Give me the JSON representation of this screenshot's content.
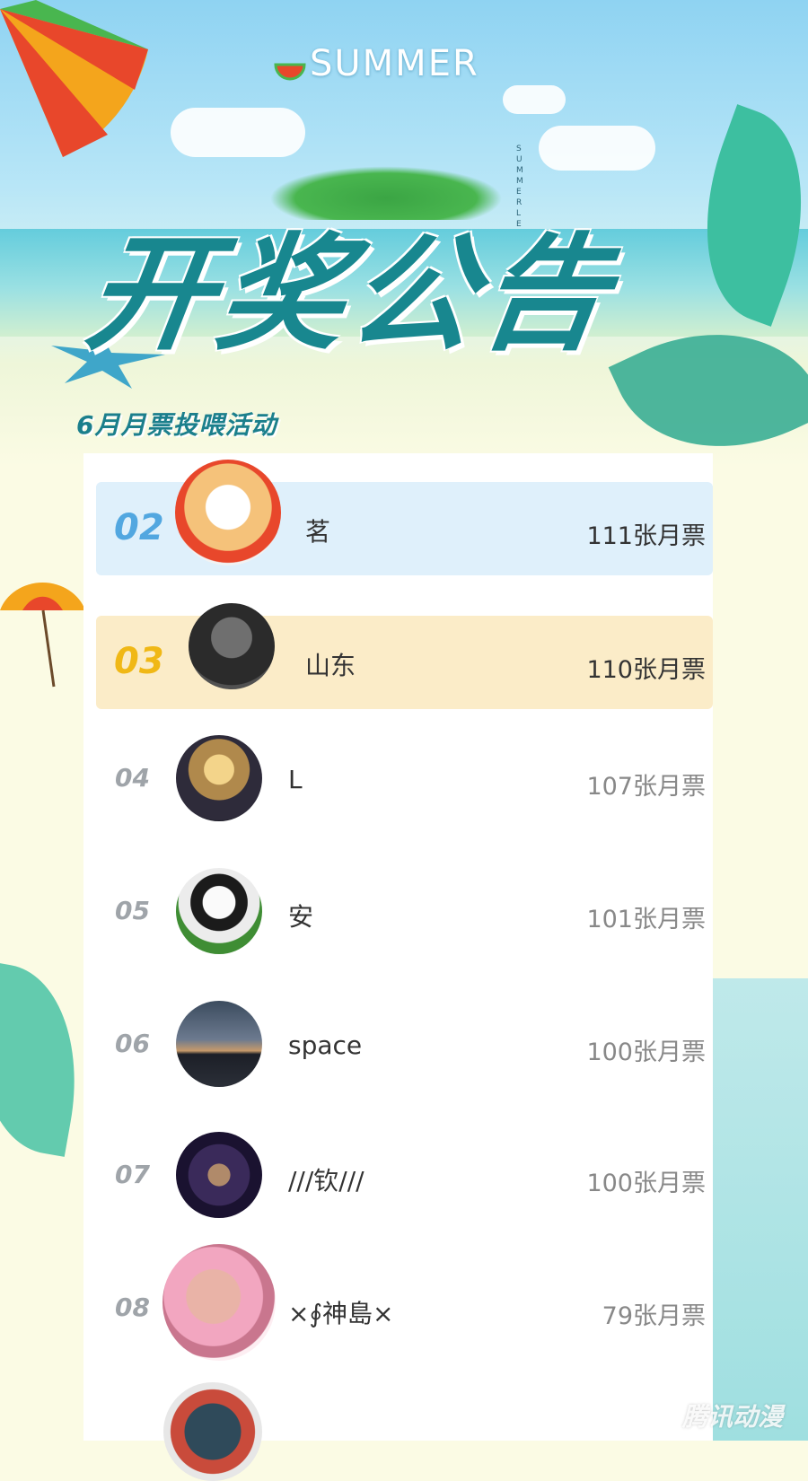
{
  "header": {
    "summer_text": "SUMMER",
    "summer_vertical": "SUMMER LE",
    "title": "开奖公告",
    "subtitle": "6月月票投喂活动"
  },
  "ranking": [
    {
      "rank": "02",
      "name": "茗",
      "votes": "111张月票",
      "highlight": "blue"
    },
    {
      "rank": "03",
      "name": "山东",
      "votes": "110张月票",
      "highlight": "yellow"
    },
    {
      "rank": "04",
      "name": "L",
      "votes": "107张月票",
      "highlight": "none"
    },
    {
      "rank": "05",
      "name": "安",
      "votes": "101张月票",
      "highlight": "none"
    },
    {
      "rank": "06",
      "name": "space",
      "votes": "100张月票",
      "highlight": "none"
    },
    {
      "rank": "07",
      "name": "///钦///",
      "votes": "100张月票",
      "highlight": "none"
    },
    {
      "rank": "08",
      "name": "×∮神島×",
      "votes": "79张月票",
      "highlight": "none"
    }
  ],
  "watermark": "腾讯动漫",
  "colors": {
    "title": "#18878f",
    "rank_02": "#52a7e0",
    "rank_03": "#f0b816",
    "rank_default": "#9fa4a9",
    "row_02_bg": "#dff0fb",
    "row_03_bg": "#fbecc8"
  }
}
